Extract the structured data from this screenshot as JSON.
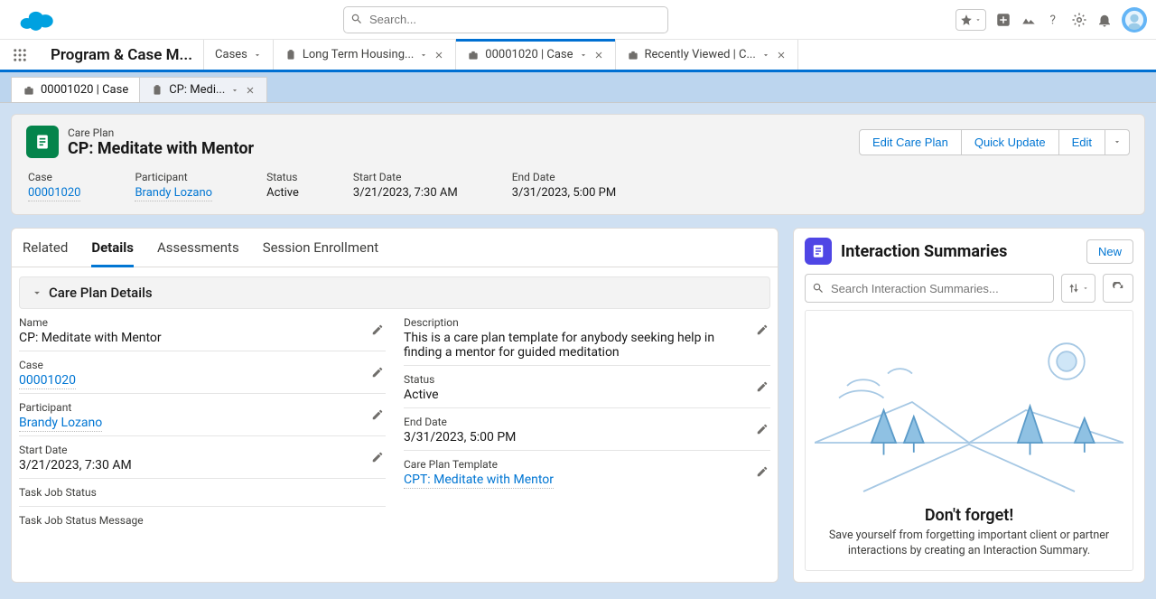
{
  "topbar": {
    "search_placeholder": "Search...",
    "app_name": "Program & Case M..."
  },
  "nav_tabs": [
    {
      "label": "Cases",
      "closable": false
    },
    {
      "label": "Long Term Housing...",
      "closable": true,
      "icon": "clipboard"
    },
    {
      "label": "00001020 | Case",
      "closable": true,
      "icon": "briefcase",
      "active": true
    },
    {
      "label": "Recently Viewed | C...",
      "closable": true,
      "icon": "briefcase"
    }
  ],
  "workspace_tabs": [
    {
      "label": "00001020 | Case",
      "icon": "briefcase"
    },
    {
      "label": "CP: Medi...",
      "icon": "clipboard",
      "active": true,
      "closable": true
    }
  ],
  "highlights": {
    "type_label": "Care Plan",
    "title": "CP: Meditate with Mentor",
    "actions": {
      "edit_care_plan": "Edit Care Plan",
      "quick_update": "Quick Update",
      "edit": "Edit"
    },
    "fields": {
      "case": {
        "label": "Case",
        "value": "00001020",
        "link": true
      },
      "participant": {
        "label": "Participant",
        "value": "Brandy Lozano",
        "link": true
      },
      "status": {
        "label": "Status",
        "value": "Active"
      },
      "start_date": {
        "label": "Start Date",
        "value": "3/21/2023, 7:30 AM"
      },
      "end_date": {
        "label": "End Date",
        "value": "3/31/2023, 5:00 PM"
      }
    }
  },
  "detail_tabs": {
    "related": "Related",
    "details": "Details",
    "assessments": "Assessments",
    "session_enrollment": "Session Enrollment",
    "active": "details"
  },
  "section": {
    "title": "Care Plan Details"
  },
  "details": {
    "left": {
      "name": {
        "label": "Name",
        "value": "CP: Meditate with Mentor"
      },
      "case": {
        "label": "Case",
        "value": "00001020",
        "link": true
      },
      "participant": {
        "label": "Participant",
        "value": "Brandy Lozano",
        "link": true
      },
      "start_date": {
        "label": "Start Date",
        "value": "3/21/2023, 7:30 AM"
      },
      "task_job_status": {
        "label": "Task Job Status",
        "value": ""
      },
      "task_job_status_message": {
        "label": "Task Job Status Message",
        "value": ""
      }
    },
    "right": {
      "description": {
        "label": "Description",
        "value": "This is a care plan template for anybody seeking help in finding a mentor for guided meditation"
      },
      "status": {
        "label": "Status",
        "value": "Active"
      },
      "end_date": {
        "label": "End Date",
        "value": "3/31/2023, 5:00 PM"
      },
      "care_plan_template": {
        "label": "Care Plan Template",
        "value": "CPT: Meditate with Mentor",
        "link": true
      }
    }
  },
  "right_panel": {
    "title": "Interaction Summaries",
    "new_button": "New",
    "search_placeholder": "Search Interaction Summaries...",
    "empty_title": "Don't forget!",
    "empty_text": "Save yourself from forgetting important client or partner interactions by creating an Interaction Summary."
  }
}
